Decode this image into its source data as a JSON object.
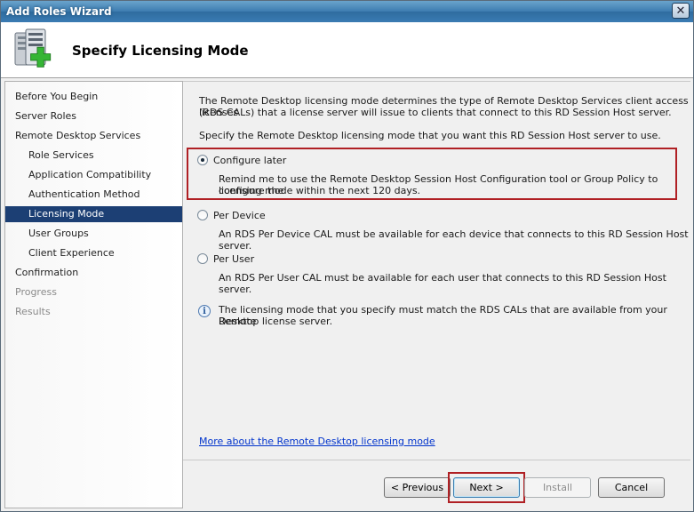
{
  "window": {
    "title": "Add Roles Wizard",
    "close_glyph": "✕"
  },
  "header": {
    "title": "Specify Licensing Mode",
    "icon": "server-add-role-icon"
  },
  "sidebar": {
    "items": [
      {
        "label": "Before You Begin",
        "level": 0,
        "state": "normal"
      },
      {
        "label": "Server Roles",
        "level": 0,
        "state": "normal"
      },
      {
        "label": "Remote Desktop Services",
        "level": 0,
        "state": "normal"
      },
      {
        "label": "Role Services",
        "level": 1,
        "state": "normal"
      },
      {
        "label": "Application Compatibility",
        "level": 1,
        "state": "normal"
      },
      {
        "label": "Authentication Method",
        "level": 1,
        "state": "normal"
      },
      {
        "label": "Licensing Mode",
        "level": 1,
        "state": "selected"
      },
      {
        "label": "User Groups",
        "level": 1,
        "state": "normal"
      },
      {
        "label": "Client Experience",
        "level": 1,
        "state": "normal"
      },
      {
        "label": "Confirmation",
        "level": 0,
        "state": "normal"
      },
      {
        "label": "Progress",
        "level": 0,
        "state": "disabled"
      },
      {
        "label": "Results",
        "level": 0,
        "state": "disabled"
      }
    ]
  },
  "content": {
    "intro_line1": "The Remote Desktop licensing mode determines the type of Remote Desktop Services client access licenses",
    "intro_line2": "(RDS CALs) that a license server will issue to clients that connect to this RD Session Host server.",
    "prompt": "Specify the Remote Desktop licensing mode that you want this RD Session Host server to use.",
    "options": [
      {
        "label": "Configure later",
        "desc_line1": "Remind me to use the Remote Desktop Session Host Configuration tool or Group Policy to configure the",
        "desc_line2": "licensing mode within the next 120 days.",
        "checked": true
      },
      {
        "label": "Per Device",
        "desc_line1": "An RDS Per Device CAL must be available for each device that connects to this RD Session Host server.",
        "checked": false
      },
      {
        "label": "Per User",
        "desc_line1": "An RDS Per User CAL must be available for each user that connects to this RD Session Host server.",
        "checked": false
      }
    ],
    "info_glyph": "i",
    "info_line1": "The licensing mode that you specify must match the RDS CALs that are available from your Remote",
    "info_line2": "Desktop license server.",
    "more_link": "More about the Remote Desktop licensing mode"
  },
  "footer": {
    "previous": "< Previous",
    "next": "Next >",
    "install": "Install",
    "cancel": "Cancel"
  },
  "colors": {
    "selection": "#1c3f74",
    "highlight_border": "#b02024",
    "link": "#0033cc"
  }
}
